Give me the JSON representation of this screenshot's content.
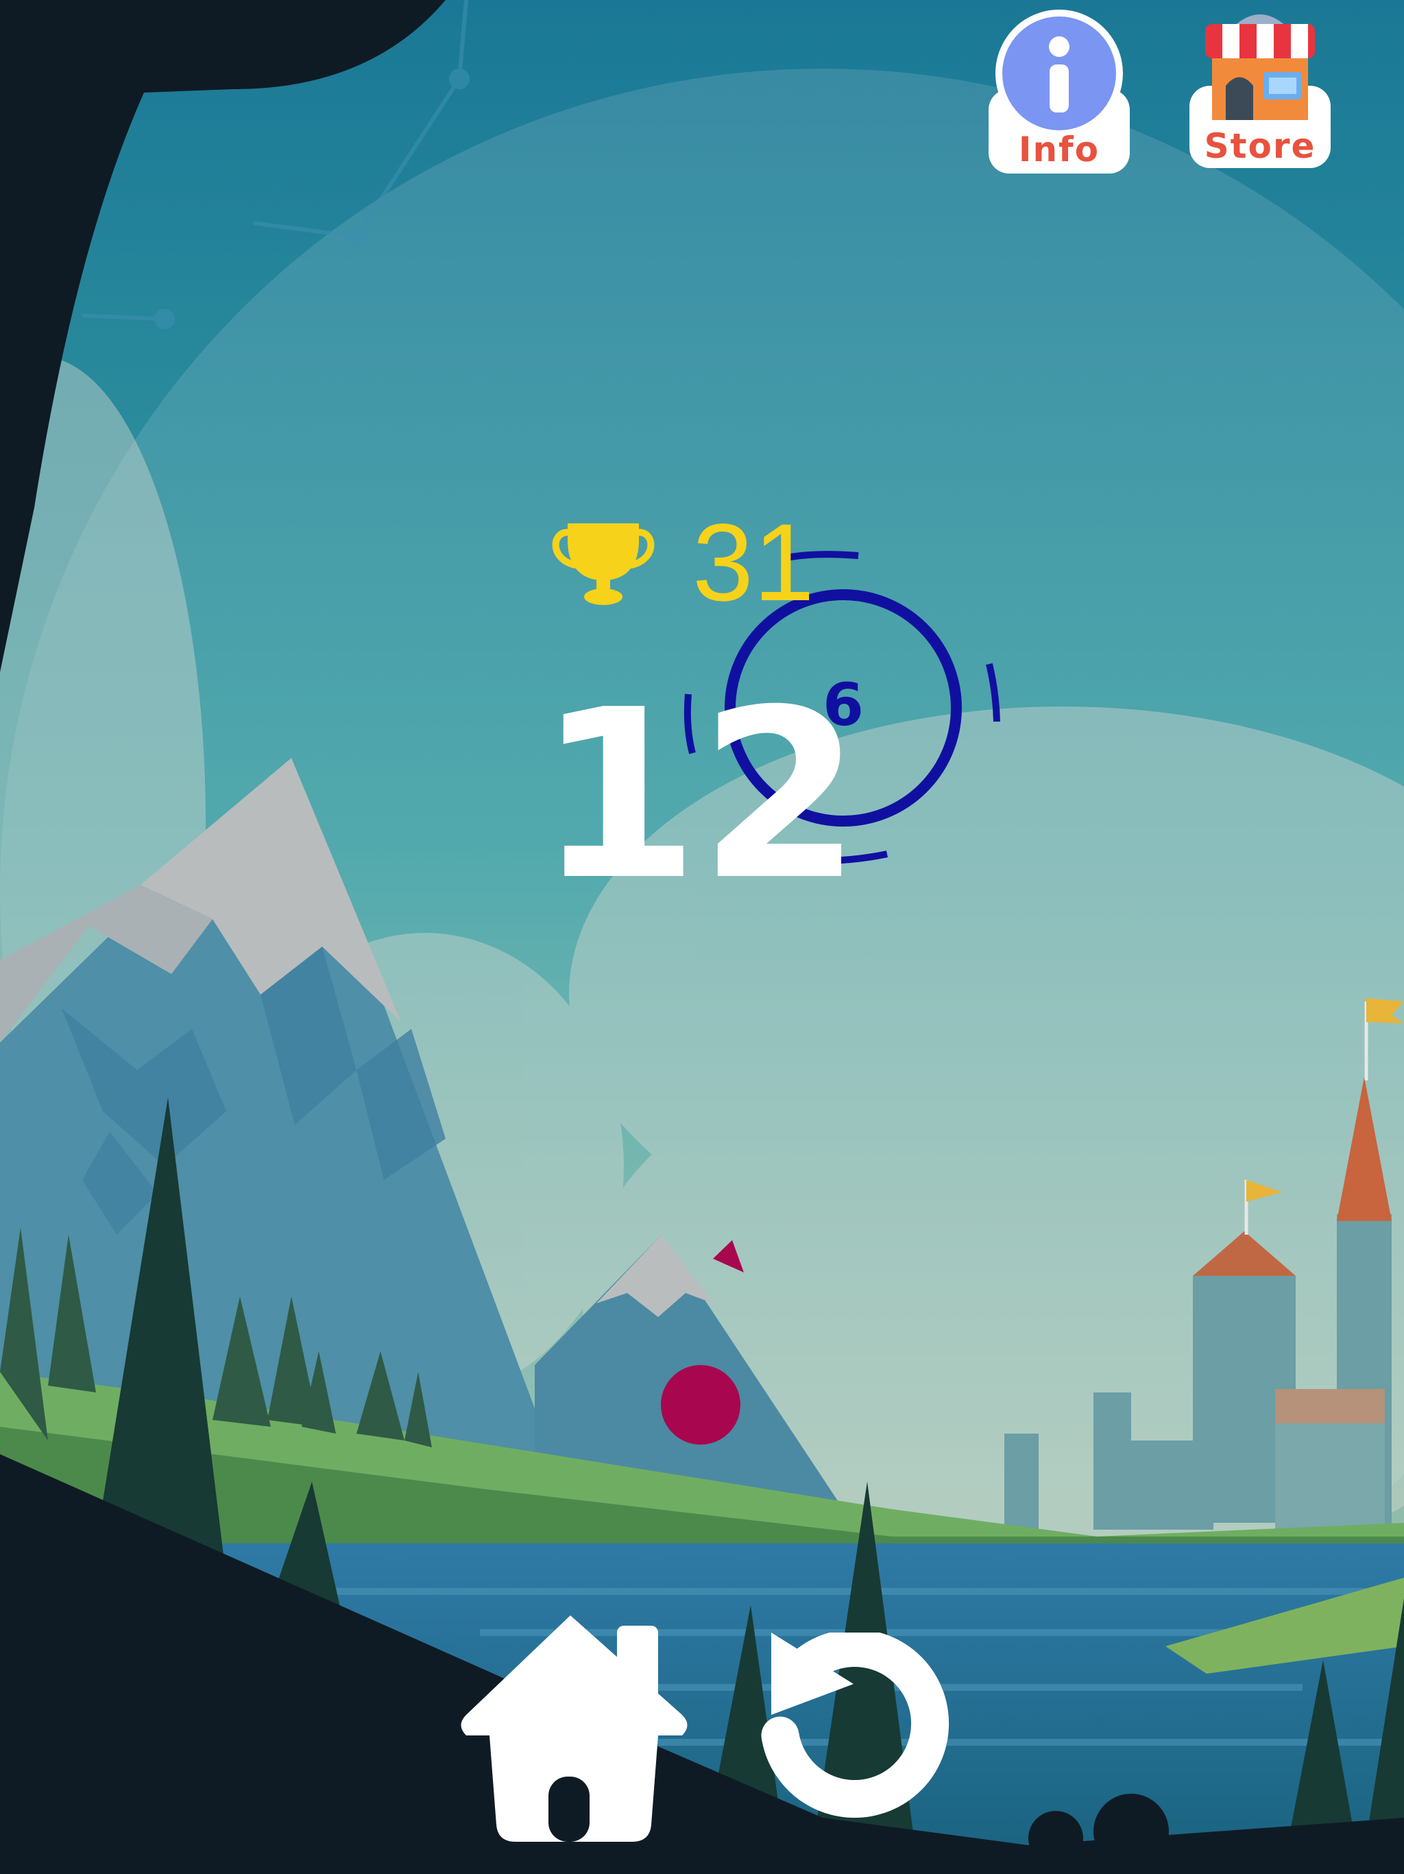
{
  "hud": {
    "best_score": "31",
    "current_score": "12",
    "target_counter": "6"
  },
  "buttons": {
    "info_label": "Info",
    "store_label": "Store"
  },
  "icons": {
    "trophy": "trophy-icon",
    "home": "home-icon",
    "restart": "restart-icon",
    "info": "info-icon",
    "store": "store-icon"
  },
  "colors": {
    "trophy": "#f7d21a",
    "score": "#ffffff",
    "ring": "#1010a0",
    "ball": "#a8074f",
    "cliff": "#0f1b24"
  }
}
